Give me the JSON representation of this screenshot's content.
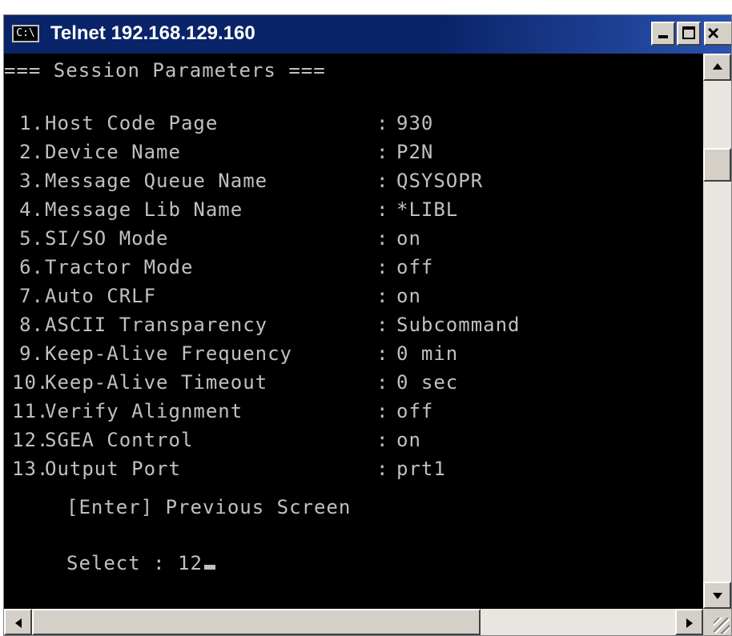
{
  "window": {
    "title": "Telnet 192.168.129.160",
    "icon": "console-icon",
    "icon_text": "C:\\"
  },
  "console": {
    "header": "=== Session Parameters ===",
    "items": [
      {
        "num": "1.",
        "label": "Host Code Page",
        "value": "930"
      },
      {
        "num": "2.",
        "label": "Device Name",
        "value": "P2N"
      },
      {
        "num": "3.",
        "label": "Message Queue Name",
        "value": "QSYSOPR"
      },
      {
        "num": "4.",
        "label": "Message Lib Name",
        "value": "*LIBL"
      },
      {
        "num": "5.",
        "label": "SI/SO Mode",
        "value": "on"
      },
      {
        "num": "6.",
        "label": "Tractor Mode",
        "value": "off"
      },
      {
        "num": "7.",
        "label": "Auto CRLF",
        "value": "on"
      },
      {
        "num": "8.",
        "label": "ASCII Transparency",
        "value": "Subcommand"
      },
      {
        "num": "9.",
        "label": "Keep-Alive Frequency",
        "value": "0 min"
      },
      {
        "num": "10.",
        "label": "Keep-Alive Timeout",
        "value": "0 sec"
      },
      {
        "num": "11.",
        "label": "Verify Alignment",
        "value": "off"
      },
      {
        "num": "12.",
        "label": "SGEA Control",
        "value": "on"
      },
      {
        "num": "13.",
        "label": "Output Port",
        "value": "prt1"
      }
    ],
    "colon": ":",
    "enter_hint": "[Enter] Previous Screen",
    "prompt_label": "Select : ",
    "prompt_value": "12"
  },
  "colors": {
    "titlebar": "#0a246a",
    "console_bg": "#000000",
    "console_text": "#c0c0c0",
    "chrome": "#d4d0c8"
  }
}
